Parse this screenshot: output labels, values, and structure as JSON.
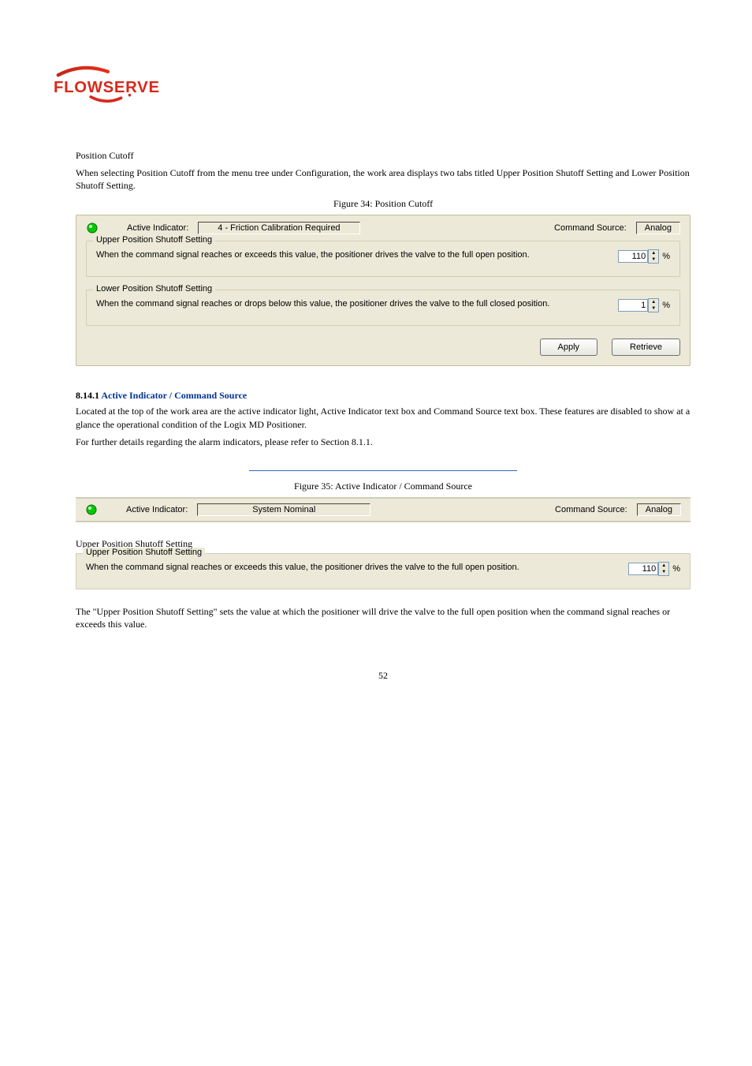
{
  "logo": {
    "word": "FLOWSERVE"
  },
  "section_a": {
    "title": "Position Cutoff",
    "text": "When selecting Position Cutoff from the menu tree under Configuration, the work area displays two tabs titled Upper Position Shutoff Setting and Lower Position Shutoff Setting.",
    "figure_label": "Figure 34: Position Cutoff"
  },
  "panel1": {
    "active_indicator_label": "Active Indicator:",
    "active_indicator_value": "4 - Friction Calibration Required",
    "command_source_label": "Command Source:",
    "command_source_value": "Analog",
    "upper": {
      "legend": "Upper Position Shutoff Setting",
      "text": "When the command signal reaches or exceeds this value, the positioner drives the valve to the full open position.",
      "value": "110",
      "unit": "%"
    },
    "lower": {
      "legend": "Lower Position Shutoff Setting",
      "text": "When the command signal reaches or drops below this value, the positioner drives the valve to the full closed position.",
      "value": "1",
      "unit": "%"
    },
    "apply": "Apply",
    "retrieve": "Retrieve"
  },
  "section_b": {
    "heading_prefix": "8.14.1",
    "heading_blue": "Active Indicator / Command Source",
    "text1": "Located at the top of the work area are the active indicator light, Active Indicator text box and Command Source text box. These features are disabled to show at a glance the operational condition of the Logix MD Positioner.",
    "text2": "For further details regarding the alarm indicators, please refer to Section 8.1.1.",
    "figure_label": "Figure 35: Active Indicator / Command Source"
  },
  "status_bar": {
    "active_indicator_label": "Active Indicator:",
    "active_indicator_value": "System Nominal",
    "command_source_label": "Command Source:",
    "command_source_value": "Analog"
  },
  "section_c": {
    "title": "Upper Position Shutoff Setting",
    "panel": {
      "legend": "Upper Position Shutoff Setting",
      "text": "When the command signal reaches or exceeds this value, the positioner drives the valve to the full open position.",
      "value": "110",
      "unit": "%"
    },
    "foot": "The \"Upper Position Shutoff Setting\" sets the value at which the positioner will drive the valve to the full open position when the command signal reaches or exceeds this value."
  },
  "page_number": "52"
}
